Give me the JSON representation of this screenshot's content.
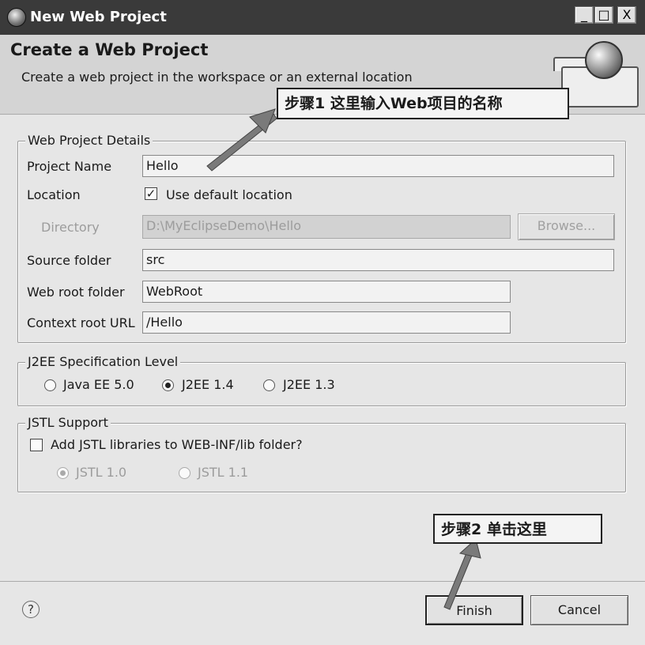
{
  "window": {
    "title": "New Web Project",
    "minimize": "_",
    "maximize": "□",
    "close": "X"
  },
  "banner": {
    "title": "Create a Web Project",
    "description": "Create a web project in the workspace or an external location"
  },
  "details": {
    "legend": "Web Project Details",
    "project_name_label": "Project Name",
    "project_name_value": "Hello",
    "location_label": "Location",
    "use_default_label": "Use default location",
    "directory_label": "Directory",
    "directory_value": "D:\\MyEclipseDemo\\Hello",
    "browse_label": "Browse...",
    "source_folder_label": "Source folder",
    "source_folder_value": "src",
    "web_root_label": "Web root folder",
    "web_root_value": "WebRoot",
    "context_root_label": "Context root URL",
    "context_root_value": "/Hello"
  },
  "j2ee": {
    "legend": "J2EE Specification Level",
    "options": [
      "Java EE 5.0",
      "J2EE 1.4",
      "J2EE 1.3"
    ],
    "selected": "J2EE 1.4"
  },
  "jstl": {
    "legend": "JSTL Support",
    "add_label": "Add JSTL libraries to WEB-INF/lib folder?",
    "versions": [
      "JSTL 1.0",
      "JSTL 1.1"
    ]
  },
  "annotations": {
    "step1": "步骤1  这里输入Web项目的名称",
    "step2": "步骤2  单击这里"
  },
  "footer": {
    "help": "?",
    "finish_label": "Finish",
    "cancel_label": "Cancel"
  },
  "icons": [
    "app-icon",
    "globe-folder-icon",
    "help-icon",
    "arrow-icon"
  ]
}
